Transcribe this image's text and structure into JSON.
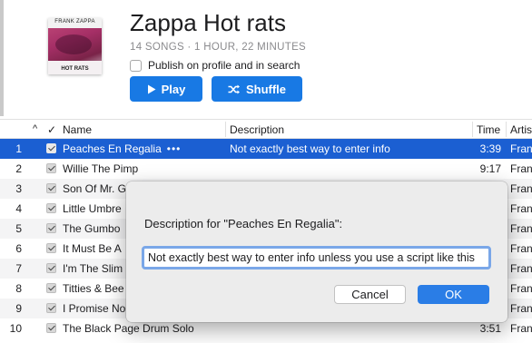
{
  "album": {
    "cover_top_text": "FRANK ZAPPA",
    "cover_bottom_text": "HOT RATS",
    "title": "Zappa Hot rats",
    "meta": "14 SONGS · 1 HOUR, 22 MINUTES",
    "publish_label": "Publish on profile and in search",
    "play_label": "Play",
    "shuffle_label": "Shuffle",
    "play_icon": "play-icon",
    "shuffle_icon": "shuffle-icon"
  },
  "table": {
    "headers": {
      "sort": "^",
      "check": "✓",
      "name": "Name",
      "description": "Description",
      "time": "Time",
      "artist": "Artis"
    },
    "rows": [
      {
        "num": "1",
        "name": "Peaches En Regalia",
        "dots": "•••",
        "description": "Not exactly best way to enter info",
        "time": "3:39",
        "artist": "Fran"
      },
      {
        "num": "2",
        "name": "Willie The Pimp",
        "description": "",
        "time": "9:17",
        "artist": "Fran"
      },
      {
        "num": "3",
        "name": "Son Of Mr. G",
        "description": "",
        "time": "",
        "artist": "Fran"
      },
      {
        "num": "4",
        "name": "Little Umbre",
        "description": "",
        "time": "",
        "artist": "Fran"
      },
      {
        "num": "5",
        "name": "The Gumbo",
        "description": "",
        "time": "",
        "artist": "Fran"
      },
      {
        "num": "6",
        "name": "It Must Be A",
        "description": "",
        "time": "",
        "artist": "Fran"
      },
      {
        "num": "7",
        "name": "I'm The Slim",
        "description": "",
        "time": "",
        "artist": "Fran"
      },
      {
        "num": "8",
        "name": "Titties & Bee",
        "description": "",
        "time": "",
        "artist": "Fran"
      },
      {
        "num": "9",
        "name": "I Promise No",
        "description": "",
        "time": "",
        "artist": "Fran"
      },
      {
        "num": "10",
        "name": "The Black Page Drum Solo",
        "description": "",
        "time": "3:51",
        "artist": "Fran"
      }
    ]
  },
  "dialog": {
    "label": "Description for \"Peaches En Regalia\":",
    "input_value": "Not exactly best way to enter info unless you use a script like this",
    "cancel_label": "Cancel",
    "ok_label": "OK"
  },
  "colors": {
    "accent": "#1879e4",
    "selected_row": "#1b5fd2"
  }
}
